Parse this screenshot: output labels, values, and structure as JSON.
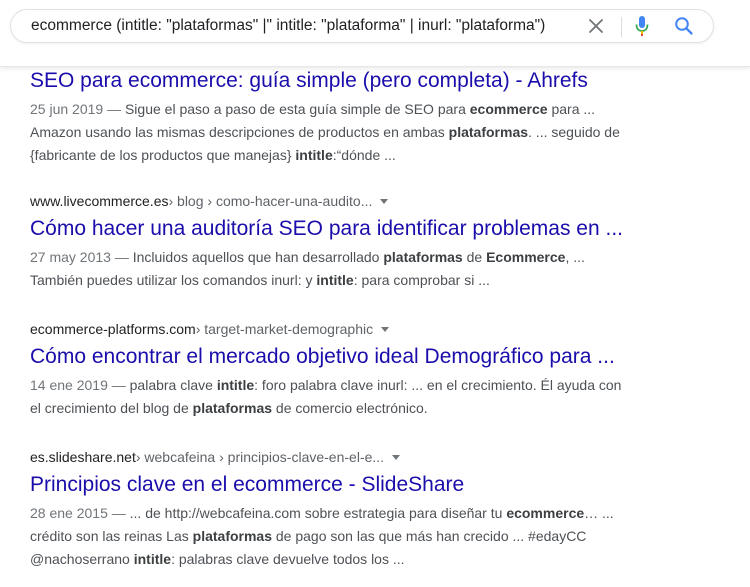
{
  "search": {
    "query": "ecommerce (intitle: \"plataformas\" |\" intitle: \"plataforma\" | inurl: \"plataforma\")"
  },
  "icons": {
    "clear": "close-icon",
    "mic": "microphone-icon",
    "search": "search-icon"
  },
  "colors": {
    "title": "#1a0dab",
    "snippet": "#4d5156",
    "mic_blue": "#4285f4",
    "mic_red": "#ea4335",
    "search_blue": "#4285f4"
  },
  "results": [
    {
      "title": "SEO para ecommerce: guía simple (pero completa) - Ahrefs",
      "date": "25 jun 2019 —",
      "snippet_lines": [
        [
          {
            "t": " Sigue el paso a paso de esta guía simple de SEO para ",
            "b": false
          },
          {
            "t": "ecommerce",
            "b": true
          },
          {
            "t": " para ...",
            "b": false
          }
        ],
        [
          {
            "t": "Amazon usando las mismas descripciones de productos en ambas ",
            "b": false
          },
          {
            "t": "plataformas",
            "b": true
          },
          {
            "t": ". ... seguido de",
            "b": false
          }
        ],
        [
          {
            "t": "{fabricante de los productos que manejas} ",
            "b": false
          },
          {
            "t": "intitle",
            "b": true
          },
          {
            "t": ":“dónde ...",
            "b": false
          }
        ]
      ]
    },
    {
      "domain": "www.livecommerce.es",
      "path": " › blog › como-hacer-una-audito...",
      "title": "Cómo hacer una auditoría SEO para identificar problemas en ...",
      "date": "27 may 2013 —",
      "snippet_lines": [
        [
          {
            "t": " Incluidos aquellos que han desarrollado ",
            "b": false
          },
          {
            "t": "plataformas",
            "b": true
          },
          {
            "t": " de ",
            "b": false
          },
          {
            "t": "Ecommerce",
            "b": true
          },
          {
            "t": ", ...",
            "b": false
          }
        ],
        [
          {
            "t": "También puedes utilizar los comandos inurl: y ",
            "b": false
          },
          {
            "t": "intitle",
            "b": true
          },
          {
            "t": ": para comprobar si ...",
            "b": false
          }
        ]
      ]
    },
    {
      "domain": "ecommerce-platforms.com",
      "path": " › target-market-demographic",
      "title": "Cómo encontrar el mercado objetivo ideal Demográfico para ...",
      "date": "14 ene 2019 —",
      "snippet_lines": [
        [
          {
            "t": " palabra clave ",
            "b": false
          },
          {
            "t": "intitle",
            "b": true
          },
          {
            "t": ": foro palabra clave inurl: ... en el crecimiento. Él ayuda con",
            "b": false
          }
        ],
        [
          {
            "t": "el crecimiento del blog de ",
            "b": false
          },
          {
            "t": "plataformas",
            "b": true
          },
          {
            "t": " de comercio electrónico.",
            "b": false
          }
        ]
      ]
    },
    {
      "domain": "es.slideshare.net",
      "path": " › webcafeina › principios-clave-en-el-e...",
      "title": "Principios clave en el ecommerce - SlideShare",
      "date": "28 ene 2015 —",
      "snippet_lines": [
        [
          {
            "t": " ... de http://webcafeina.com sobre estrategia para diseñar tu ",
            "b": false
          },
          {
            "t": "ecommerce",
            "b": true
          },
          {
            "t": "… ...",
            "b": false
          }
        ],
        [
          {
            "t": "crédito son las reinas Las ",
            "b": false
          },
          {
            "t": "plataformas",
            "b": true
          },
          {
            "t": " de pago son las que más han crecido ... #edayCC",
            "b": false
          }
        ],
        [
          {
            "t": "@nachoserrano ",
            "b": false
          },
          {
            "t": "intitle",
            "b": true
          },
          {
            "t": ": palabras clave devuelve todos los ...",
            "b": false
          }
        ]
      ]
    }
  ]
}
